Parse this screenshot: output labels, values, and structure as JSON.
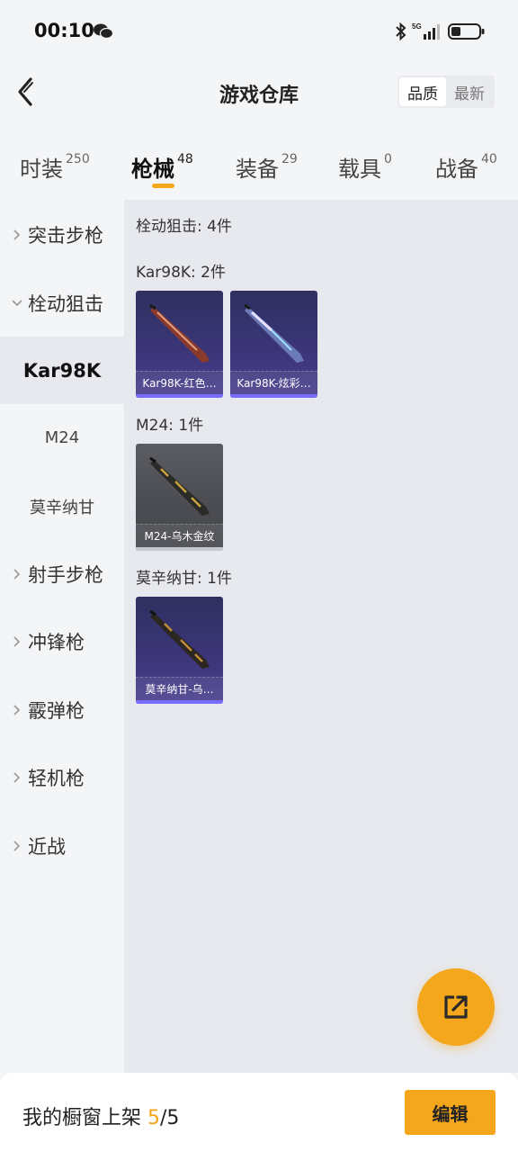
{
  "status_bar": {
    "time": "00:10",
    "network": "5G"
  },
  "header": {
    "title": "游戏仓库",
    "sort_options": [
      "品质",
      "最新"
    ],
    "sort_selected": "品质"
  },
  "tabs": [
    {
      "label": "时装",
      "count": "250"
    },
    {
      "label": "枪械",
      "count": "48"
    },
    {
      "label": "装备",
      "count": "29"
    },
    {
      "label": "载具",
      "count": "0"
    },
    {
      "label": "战备",
      "count": "40"
    }
  ],
  "active_tab": "枪械",
  "sidebar": {
    "items": [
      {
        "label": "突击步枪"
      },
      {
        "label": "栓动狙击"
      },
      {
        "label": "Kar98K"
      },
      {
        "label": "M24"
      },
      {
        "label": "莫辛纳甘"
      },
      {
        "label": "射手步枪"
      },
      {
        "label": "冲锋枪"
      },
      {
        "label": "霰弹枪"
      },
      {
        "label": "轻机枪"
      },
      {
        "label": "近战"
      }
    ],
    "selected": "Kar98K"
  },
  "content": {
    "category_title": "栓动狙击: 4件",
    "groups": [
      {
        "title": "Kar98K: 2件",
        "items": [
          {
            "name": "Kar98K-红色…",
            "icon": "rifle-red-icon"
          },
          {
            "name": "Kar98K-炫彩…",
            "icon": "rifle-colorful-icon"
          }
        ]
      },
      {
        "title": "M24: 1件",
        "items": [
          {
            "name": "M24-乌木金纹",
            "icon": "rifle-ebony-gold-icon"
          }
        ]
      },
      {
        "title": "莫辛纳甘: 1件",
        "items": [
          {
            "name": "莫辛纳甘-乌…",
            "icon": "rifle-ebony-icon"
          }
        ]
      }
    ]
  },
  "bottom": {
    "label": "我的橱窗上架",
    "count": "5",
    "total": "/5",
    "edit_label": "编辑"
  },
  "colors": {
    "accent": "#f4a61c",
    "sidebar_bg": "#f4f5f7",
    "content_bg": "#e7e9ee",
    "card_purple": "#3b3578",
    "card_grey": "#4a4c52"
  }
}
